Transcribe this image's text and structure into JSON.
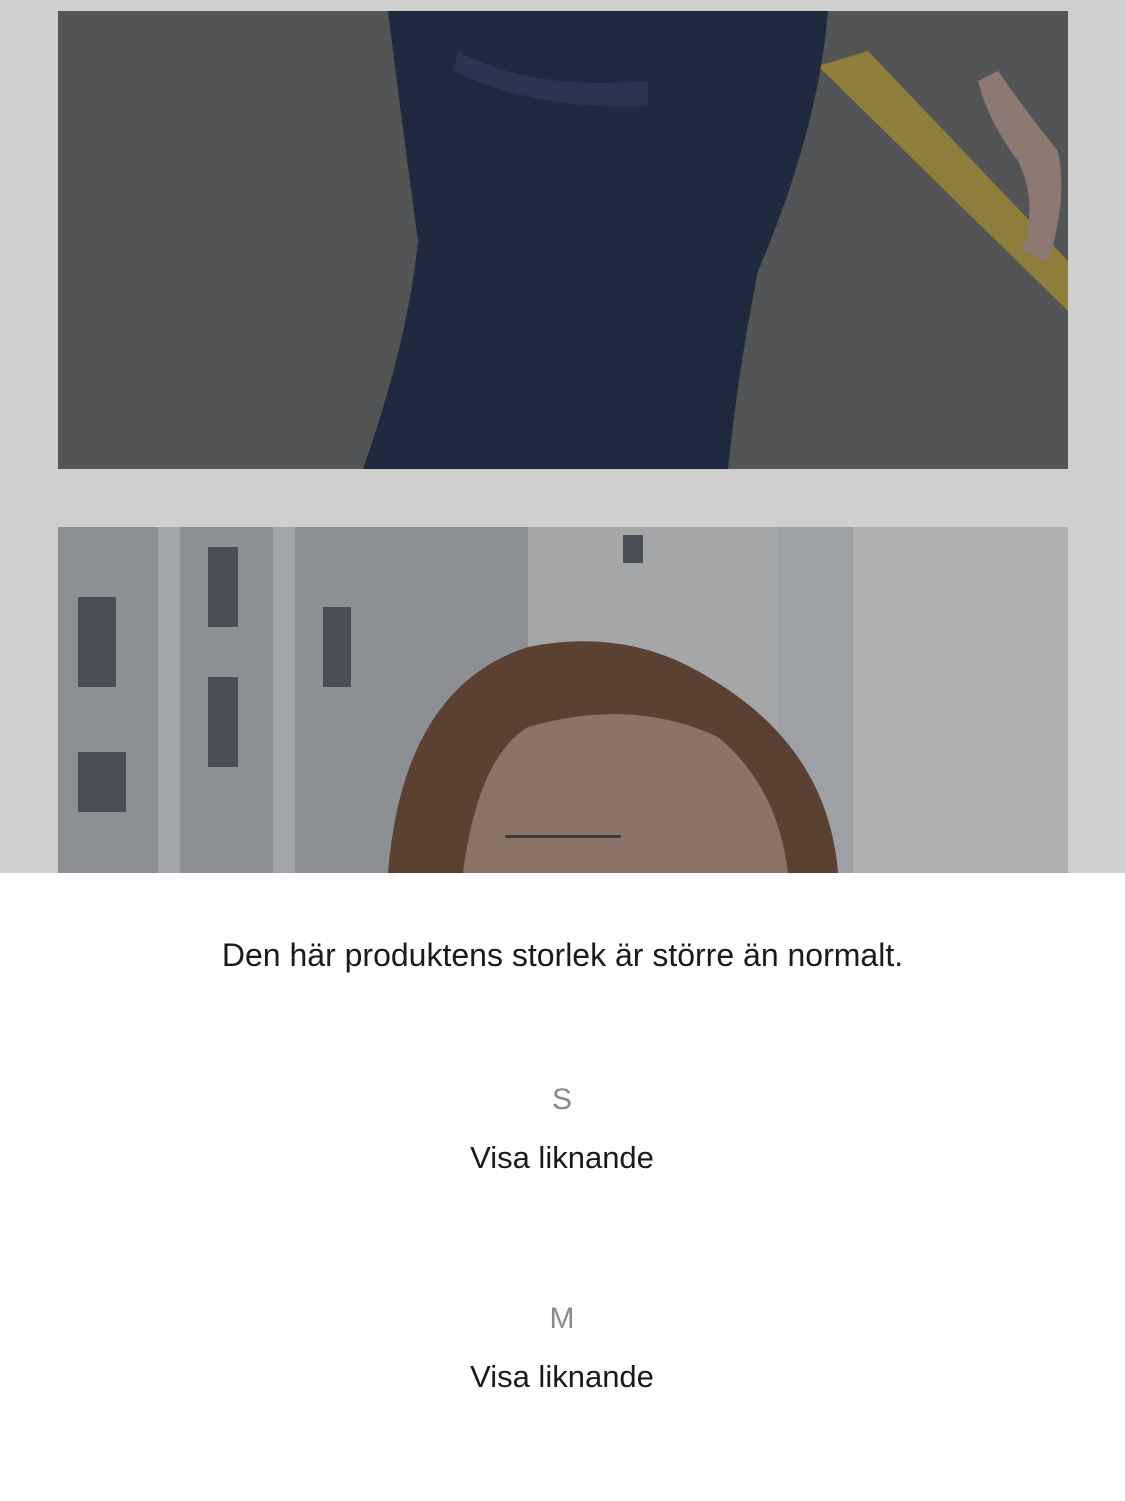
{
  "gallery": {
    "images": [
      {
        "alt": "product-photo-jeans"
      },
      {
        "alt": "product-photo-model-face"
      }
    ]
  },
  "size_sheet": {
    "message": "Den här produktens storlek är större än normalt.",
    "options": [
      {
        "size": "S",
        "action": "Visa liknande"
      },
      {
        "size": "M",
        "action": "Visa liknande"
      }
    ]
  },
  "colors": {
    "backdrop": "#cfcfcf",
    "sheet": "#ffffff",
    "text_primary": "#1a1a1a",
    "text_secondary": "#8a8a8a"
  }
}
